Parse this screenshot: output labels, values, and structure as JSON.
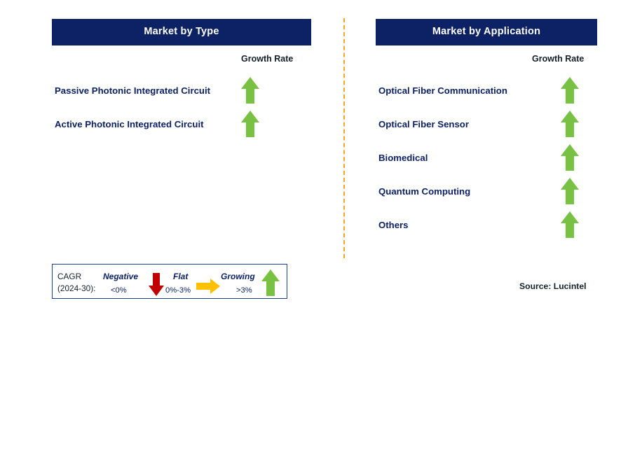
{
  "panels": [
    {
      "title": "Market by Type",
      "growth_header": "Growth Rate",
      "items": [
        {
          "label": "Passive Photonic Integrated Circuit",
          "trend": "growing"
        },
        {
          "label": "Active Photonic Integrated Circuit",
          "trend": "growing"
        }
      ]
    },
    {
      "title": "Market by Application",
      "growth_header": "Growth Rate",
      "items": [
        {
          "label": "Optical Fiber Communication",
          "trend": "growing"
        },
        {
          "label": "Optical Fiber Sensor",
          "trend": "growing"
        },
        {
          "label": "Biomedical",
          "trend": "growing"
        },
        {
          "label": "Quantum Computing",
          "trend": "growing"
        },
        {
          "label": "Others",
          "trend": "growing"
        }
      ]
    }
  ],
  "legend": {
    "cagr_line1": "CAGR",
    "cagr_line2": "(2024-30):",
    "entries": [
      {
        "term": "Negative",
        "range": "<0%",
        "icon": "arrow-down-icon"
      },
      {
        "term": "Flat",
        "range": "0%-3%",
        "icon": "arrow-right-icon"
      },
      {
        "term": "Growing",
        "range": ">3%",
        "icon": "arrow-up-icon"
      }
    ]
  },
  "source": "Source: Lucintel",
  "colors": {
    "header_bg": "#0d2265",
    "growing": "#79c143",
    "flat": "#ffc000",
    "negative": "#c00000",
    "divider": "#f5a623"
  }
}
